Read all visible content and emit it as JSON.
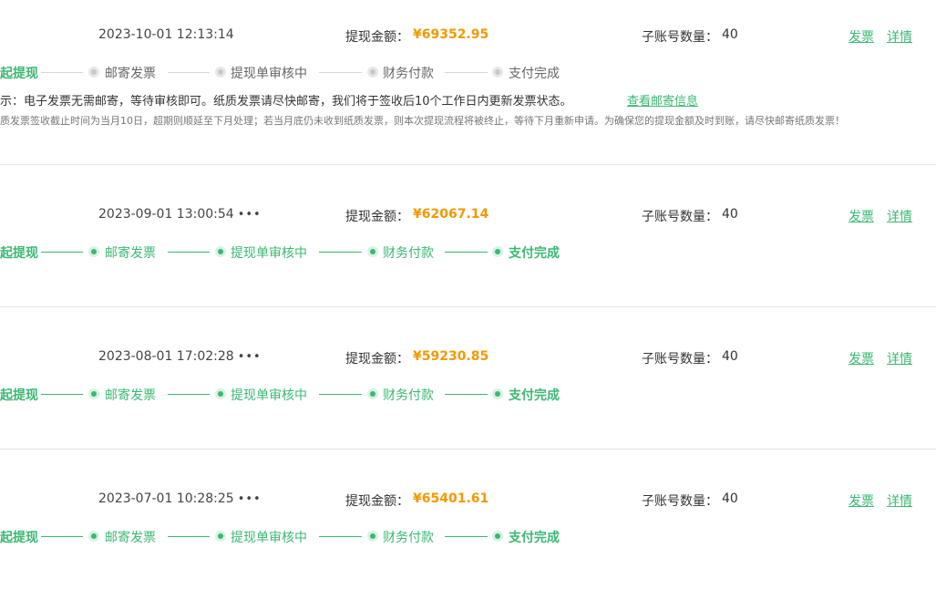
{
  "labels": {
    "amount_label": "提现金额：",
    "sub_label": "子账号数量：",
    "invoice_link": "发票",
    "detail_link": "详情",
    "more": "•••"
  },
  "steps": [
    "起提现",
    "邮寄发票",
    "提现单审核中",
    "财务付款",
    "支付完成"
  ],
  "records": [
    {
      "time": "2023-10-01 12:13:14",
      "amount": "¥69352.95",
      "sub_count": "40",
      "completed_steps": 1,
      "show_more": false,
      "notice": "示：电子发票无需邮寄，等待审核即可。纸质发票请尽快邮寄，我们将于签收后10个工作日内更新发票状态。",
      "notice_link": "查看邮寄信息",
      "notice2": "质发票签收截止时间为当月10日，超期则顺延至下月处理；若当月底仍未收到纸质发票，则本次提现流程将被终止，等待下月重新申请。为确保您的提现金额及时到账，请尽快邮寄纸质发票！"
    },
    {
      "time": "2023-09-01 13:00:54",
      "amount": "¥62067.14",
      "sub_count": "40",
      "completed_steps": 5,
      "show_more": true
    },
    {
      "time": "2023-08-01 17:02:28",
      "amount": "¥59230.85",
      "sub_count": "40",
      "completed_steps": 5,
      "show_more": true
    },
    {
      "time": "2023-07-01 10:28:25",
      "amount": "¥65401.61",
      "sub_count": "40",
      "completed_steps": 5,
      "show_more": true
    }
  ]
}
